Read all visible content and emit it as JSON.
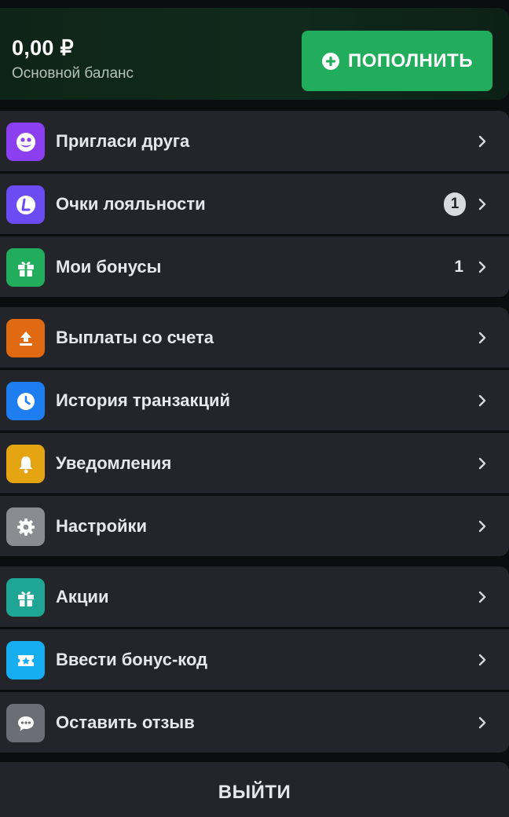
{
  "balance": {
    "amount": "0,00 ₽",
    "label": "Основной баланс",
    "topup_label": "ПОПОЛНИТЬ",
    "accent": "#22ad5c"
  },
  "menu": {
    "invite": {
      "label": "Пригласи друга",
      "icon": "invite-friend-icon",
      "color": "#8b3ff0"
    },
    "loyalty": {
      "label": "Очки лояльности",
      "icon": "loyalty-points-icon",
      "color": "#6a4cf2",
      "badge": "1"
    },
    "bonuses": {
      "label": "Мои бонусы",
      "icon": "gift-icon",
      "color": "#22ad5c",
      "count": "1"
    },
    "withdraw": {
      "label": "Выплаты со счета",
      "icon": "upload-icon",
      "color": "#e06a12"
    },
    "history": {
      "label": "История транзакций",
      "icon": "clock-icon",
      "color": "#1e7df0"
    },
    "notifications": {
      "label": "Уведомления",
      "icon": "bell-icon",
      "color": "#e5a412"
    },
    "settings": {
      "label": "Настройки",
      "icon": "gear-icon",
      "color": "#8a8c92"
    },
    "promotions": {
      "label": "Акции",
      "icon": "gift-icon",
      "color": "#1fa594"
    },
    "bonus_code": {
      "label": "Ввести бонус-код",
      "icon": "ticket-icon",
      "color": "#16aef0"
    },
    "feedback": {
      "label": "Оставить отзыв",
      "icon": "chat-icon",
      "color": "#6b6e76"
    }
  },
  "logout_label": "ВЫЙТИ"
}
